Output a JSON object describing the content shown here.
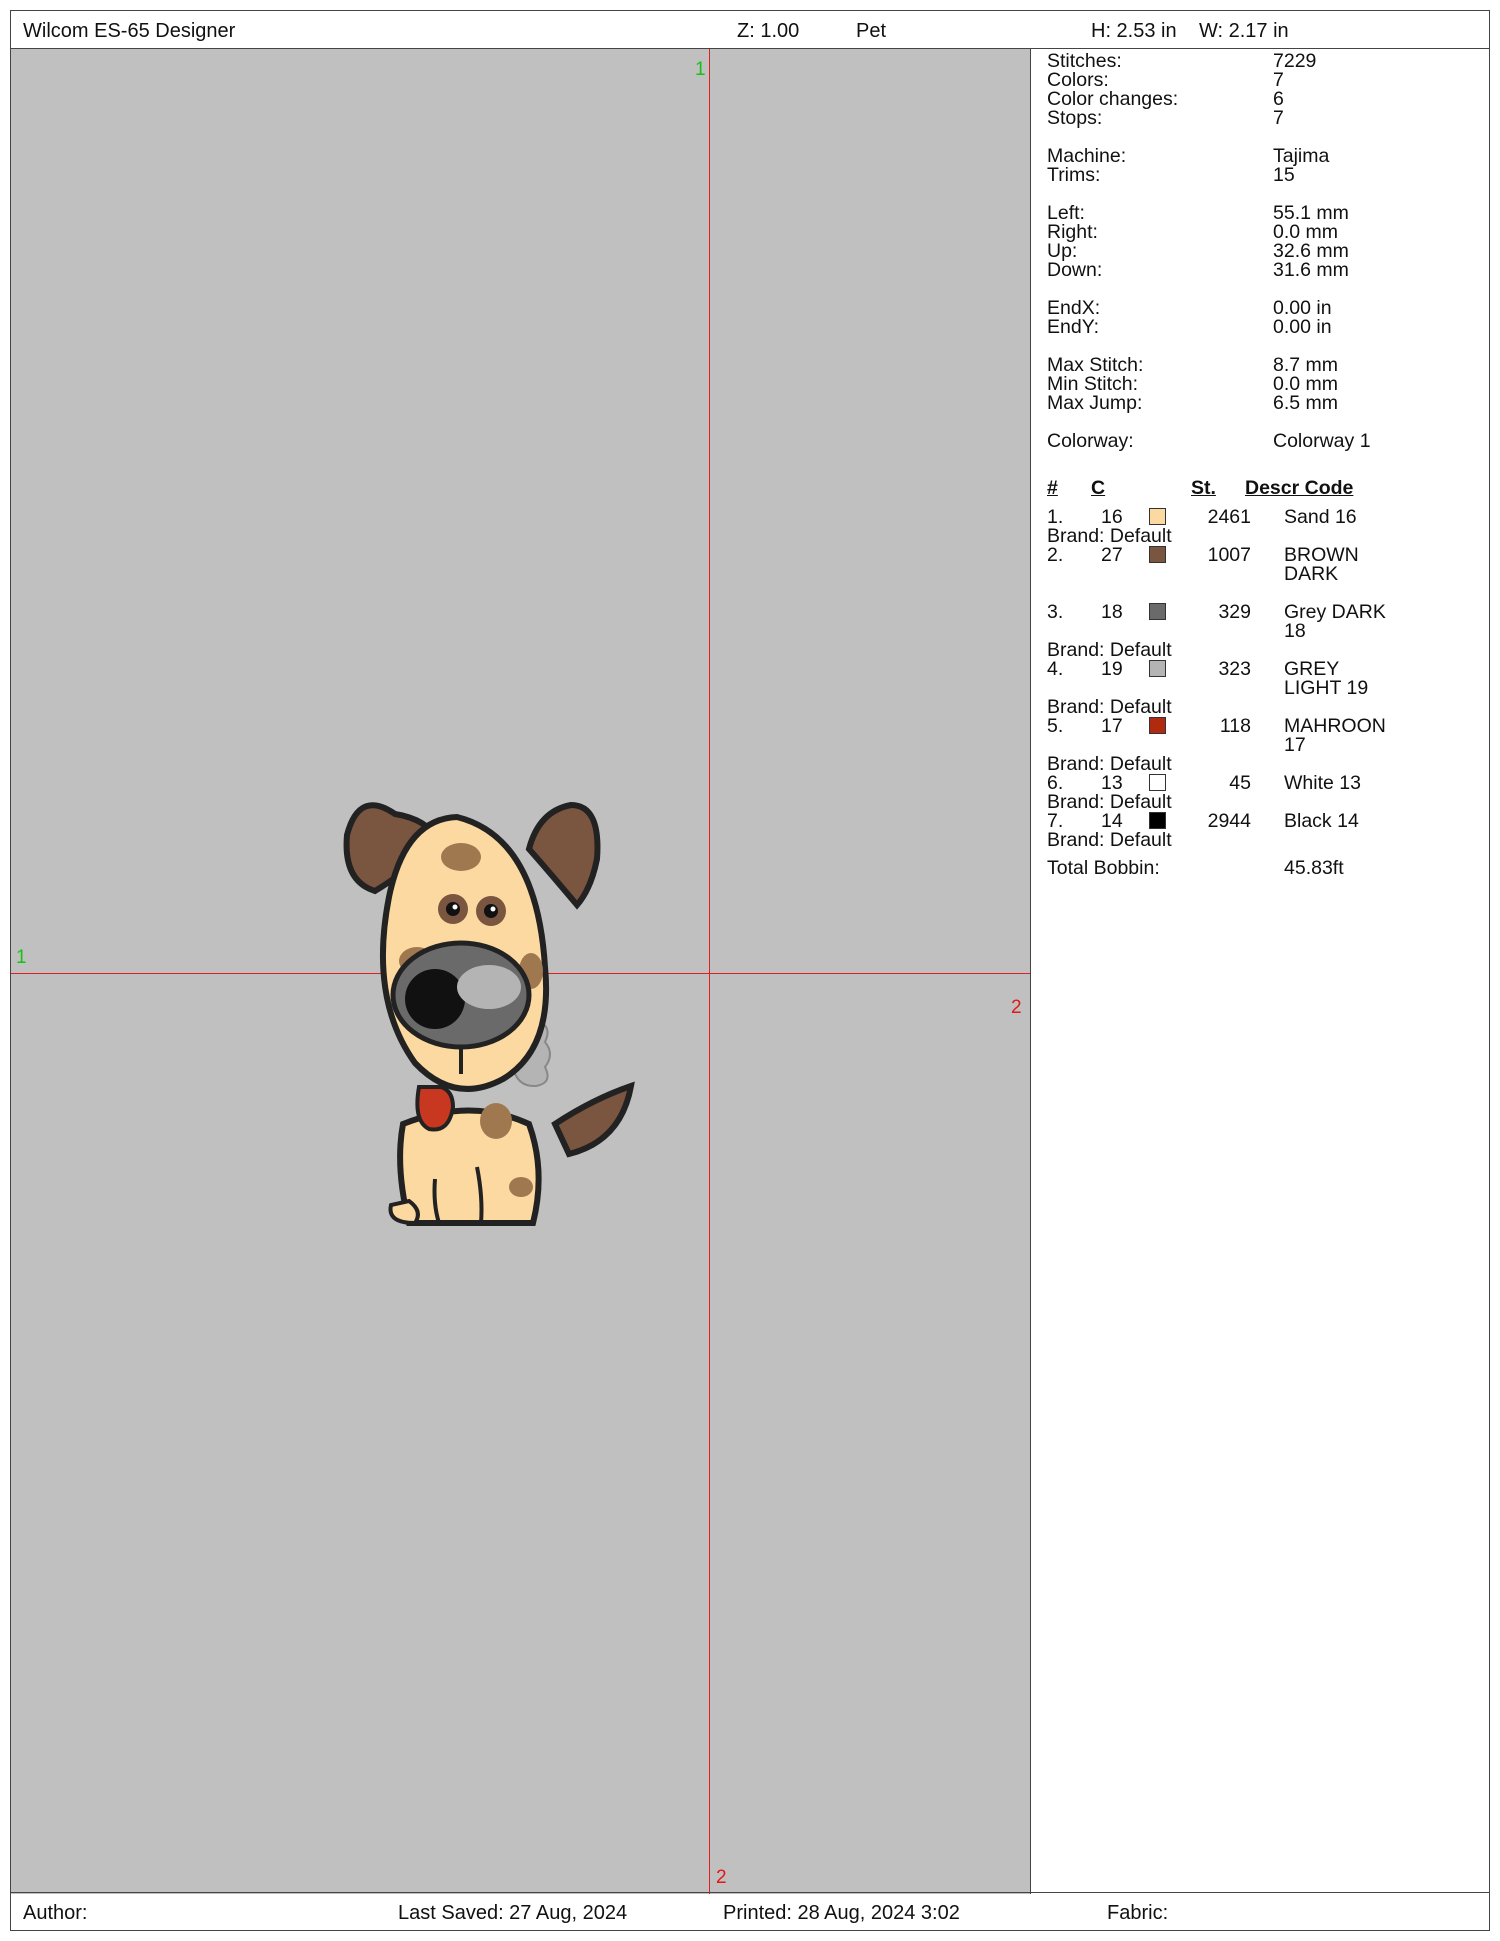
{
  "header": {
    "app_title": "Wilcom ES-65 Designer",
    "zoom": "Z: 1.00",
    "design_name": "Pet",
    "height": "H: 2.53 in",
    "width": "W: 2.17 in"
  },
  "guides": {
    "top_label": "1",
    "left_label": "1",
    "right_label": "2",
    "bottom_label": "2"
  },
  "stats": [
    {
      "label": "Stitches:",
      "value": "7229"
    },
    {
      "label": "Colors:",
      "value": "7"
    },
    {
      "label": "Color changes:",
      "value": "6"
    },
    {
      "label": "Stops:",
      "value": "7"
    },
    {
      "label": "Machine:",
      "value": "Tajima"
    },
    {
      "label": "Trims:",
      "value": "15"
    },
    {
      "label": "Left:",
      "value": "55.1 mm"
    },
    {
      "label": "Right:",
      "value": "0.0 mm"
    },
    {
      "label": "Up:",
      "value": "32.6 mm"
    },
    {
      "label": "Down:",
      "value": "31.6 mm"
    },
    {
      "label": "EndX:",
      "value": "0.00 in"
    },
    {
      "label": "EndY:",
      "value": "0.00 in"
    },
    {
      "label": "Max Stitch:",
      "value": "8.7 mm"
    },
    {
      "label": "Min Stitch:",
      "value": "0.0 mm"
    },
    {
      "label": "Max Jump:",
      "value": "6.5 mm"
    },
    {
      "label": "Colorway:",
      "value": "Colorway 1"
    }
  ],
  "table_header": {
    "num": "#",
    "code": "C",
    "stitches": "St.",
    "descr": "Descr Code"
  },
  "colors": [
    {
      "num": "1.",
      "code": "16",
      "swatch": "#fcd9a0",
      "stitches": "2461",
      "descr1": "Sand 16",
      "descr2": "",
      "brand": "Brand: Default"
    },
    {
      "num": "2.",
      "code": "27",
      "swatch": "#7a5540",
      "stitches": "1007",
      "descr1": "BROWN",
      "descr2": "DARK",
      "brand": ""
    },
    {
      "num": "3.",
      "code": "18",
      "swatch": "#6a6a6a",
      "stitches": "329",
      "descr1": "Grey DARK",
      "descr2": "18",
      "brand": "Brand: Default"
    },
    {
      "num": "4.",
      "code": "19",
      "swatch": "#b4b4b4",
      "stitches": "323",
      "descr1": "GREY",
      "descr2": "LIGHT 19",
      "brand": "Brand: Default"
    },
    {
      "num": "5.",
      "code": "17",
      "swatch": "#b02a10",
      "stitches": "118",
      "descr1": "MAHROON",
      "descr2": "17",
      "brand": "Brand: Default"
    },
    {
      "num": "6.",
      "code": "13",
      "swatch": "#ffffff",
      "stitches": "45",
      "descr1": "White 13",
      "descr2": "",
      "brand": "Brand: Default"
    },
    {
      "num": "7.",
      "code": "14",
      "swatch": "#000000",
      "stitches": "2944",
      "descr1": "Black 14",
      "descr2": "",
      "brand": "Brand: Default"
    }
  ],
  "total_bobbin": {
    "label": "Total Bobbin:",
    "value": "45.83ft"
  },
  "footer": {
    "author": "Author:",
    "last_saved": "Last Saved: 27 Aug, 2024",
    "printed": "Printed: 28 Aug, 2024  3:02",
    "fabric": "Fabric:"
  }
}
